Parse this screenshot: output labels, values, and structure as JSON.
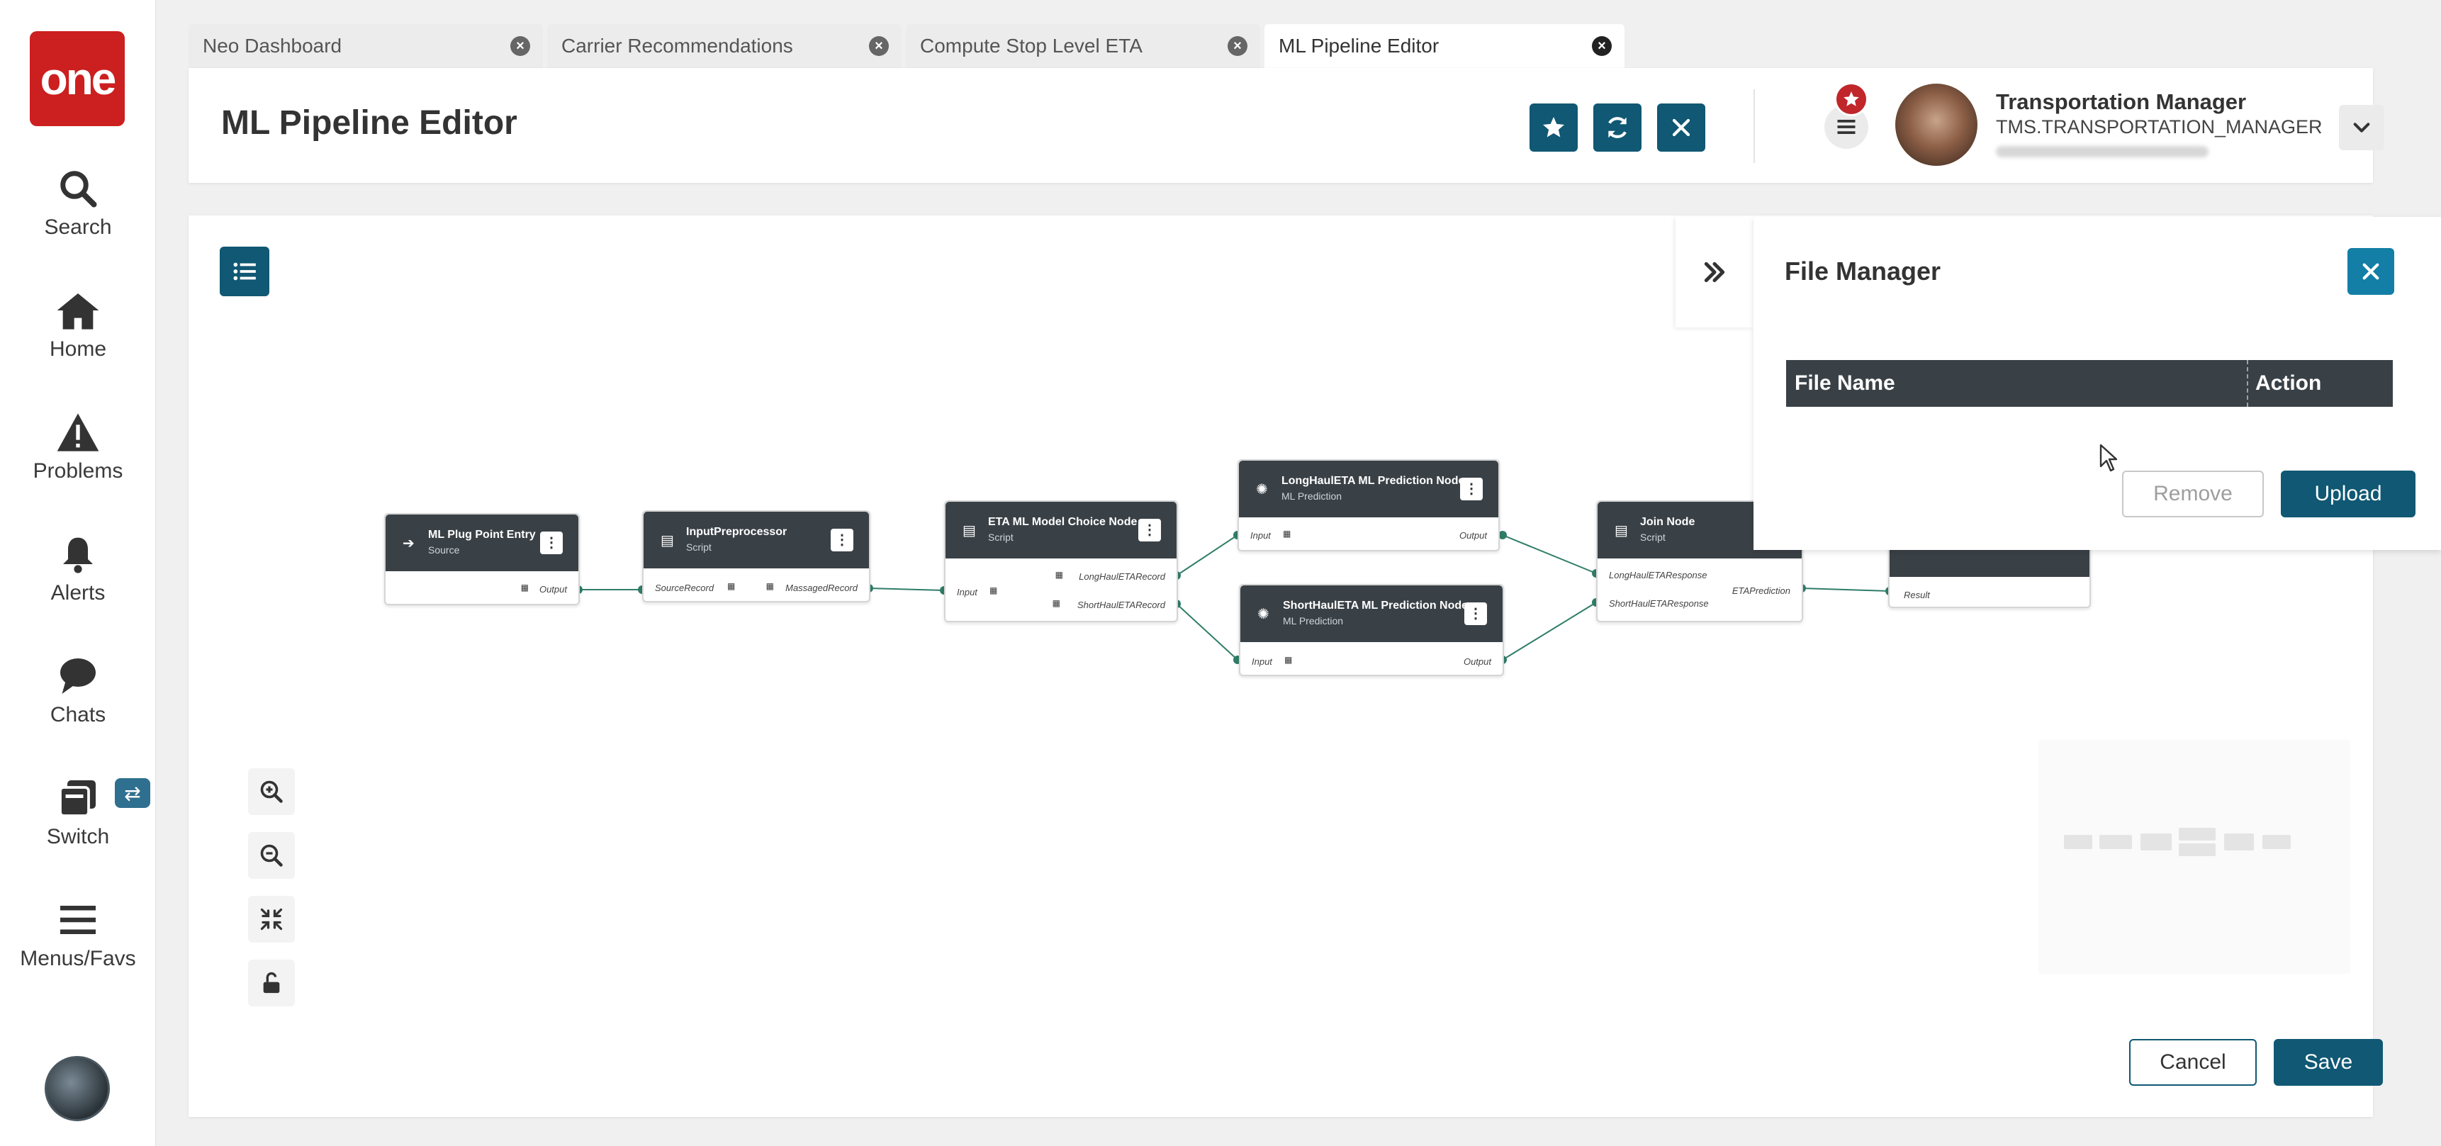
{
  "nav": {
    "logo": "one",
    "items": [
      {
        "label": "Search",
        "icon": "search-icon"
      },
      {
        "label": "Home",
        "icon": "home-icon"
      },
      {
        "label": "Problems",
        "icon": "warning-icon"
      },
      {
        "label": "Alerts",
        "icon": "bell-icon"
      },
      {
        "label": "Chats",
        "icon": "chat-icon"
      },
      {
        "label": "Switch",
        "icon": "switch-icon"
      },
      {
        "label": "Menus/Favs",
        "icon": "menu-icon"
      }
    ]
  },
  "tabs": [
    {
      "label": "Neo Dashboard",
      "active": false
    },
    {
      "label": "Carrier Recommendations",
      "active": false
    },
    {
      "label": "Compute Stop Level ETA",
      "active": false
    },
    {
      "label": "ML Pipeline Editor",
      "active": true
    }
  ],
  "header": {
    "title": "ML Pipeline Editor",
    "user_name": "Transportation Manager",
    "user_role": "TMS.TRANSPORTATION_MANAGER"
  },
  "pipeline": {
    "nodes": [
      {
        "title": "ML Plug Point Entry",
        "subtitle": "Source",
        "output": "Output"
      },
      {
        "title": "InputPreprocessor",
        "subtitle": "Script",
        "input": "SourceRecord",
        "output": "MassagedRecord"
      },
      {
        "title": "ETA ML Model Choice Node",
        "subtitle": "Script",
        "input": "Input",
        "output_a": "LongHaulETARecord",
        "output_b": "ShortHaulETARecord"
      },
      {
        "title": "LongHaulETA ML Prediction Node",
        "subtitle": "ML Prediction",
        "input": "Input",
        "output": "Output"
      },
      {
        "title": "ShortHaulETA ML Prediction Node",
        "subtitle": "ML Prediction",
        "input": "Input",
        "output": "Output"
      },
      {
        "title": "Join Node",
        "subtitle": "Script",
        "input_a": "LongHaulETAResponse",
        "input_b": "ShortHaulETAResponse",
        "output": "ETAPrediction"
      },
      {
        "input": "Result"
      }
    ]
  },
  "file_manager": {
    "title": "File Manager",
    "columns": [
      "File Name",
      "Action"
    ],
    "remove_label": "Remove",
    "upload_label": "Upload"
  },
  "footer": {
    "cancel_label": "Cancel",
    "save_label": "Save"
  },
  "colors": {
    "primary": "#105873",
    "accent": "#137ea6",
    "node_header": "#3a4146",
    "edge": "#2f7d68",
    "logo": "#cc1f1f",
    "badge": "#c0262a"
  }
}
